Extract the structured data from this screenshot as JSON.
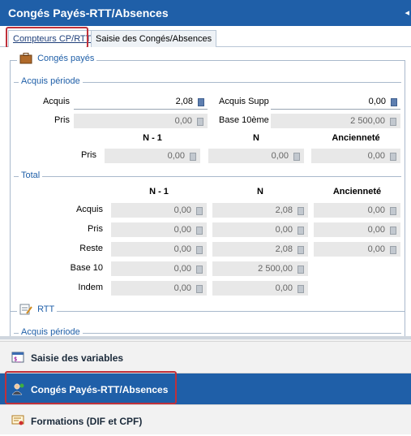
{
  "window": {
    "title": "Congés Payés-RTT/Absences",
    "collapse_glyph": "◂"
  },
  "tabs": [
    {
      "label": "Compteurs CP/RTT",
      "active": true
    },
    {
      "label": "Saisie des Congés/Absences",
      "active": false
    }
  ],
  "conges_payes": {
    "title": "Congés payés",
    "acquis_periode": {
      "title": "Acquis période",
      "acquis_label": "Acquis",
      "acquis_value": "2,08",
      "acquis_supp_label": "Acquis Supp",
      "acquis_supp_value": "0,00",
      "pris_label": "Pris",
      "pris_value": "0,00",
      "base_label": "Base 10ème",
      "base_value": "2 500,00",
      "headers": [
        "N - 1",
        "N",
        "Ancienneté"
      ],
      "pris_row": {
        "label": "Pris",
        "values": [
          "0,00",
          "0,00",
          "0,00"
        ]
      }
    },
    "total": {
      "title": "Total",
      "headers": [
        "N - 1",
        "N",
        "Ancienneté"
      ],
      "rows": [
        {
          "label": "Acquis",
          "values": [
            "0,00",
            "2,08",
            "0,00"
          ]
        },
        {
          "label": "Pris",
          "values": [
            "0,00",
            "0,00",
            "0,00"
          ]
        },
        {
          "label": "Reste",
          "values": [
            "0,00",
            "2,08",
            "0,00"
          ]
        },
        {
          "label": "Base 10",
          "values": [
            "0,00",
            "2 500,00"
          ]
        },
        {
          "label": "Indem",
          "values": [
            "0,00",
            "0,00"
          ]
        }
      ]
    }
  },
  "rtt": {
    "title": "RTT",
    "acquis_periode_title": "Acquis période"
  },
  "nav": [
    {
      "label": "Saisie des variables",
      "icon": "variables-form-icon",
      "active": false
    },
    {
      "label": "Congés Payés-RTT/Absences",
      "icon": "employee-icon",
      "active": true
    },
    {
      "label": "Formations (DIF et CPF)",
      "icon": "certificate-icon",
      "active": false
    }
  ],
  "colors": {
    "accent": "#1f5fa8",
    "highlight": "#c0303a"
  }
}
